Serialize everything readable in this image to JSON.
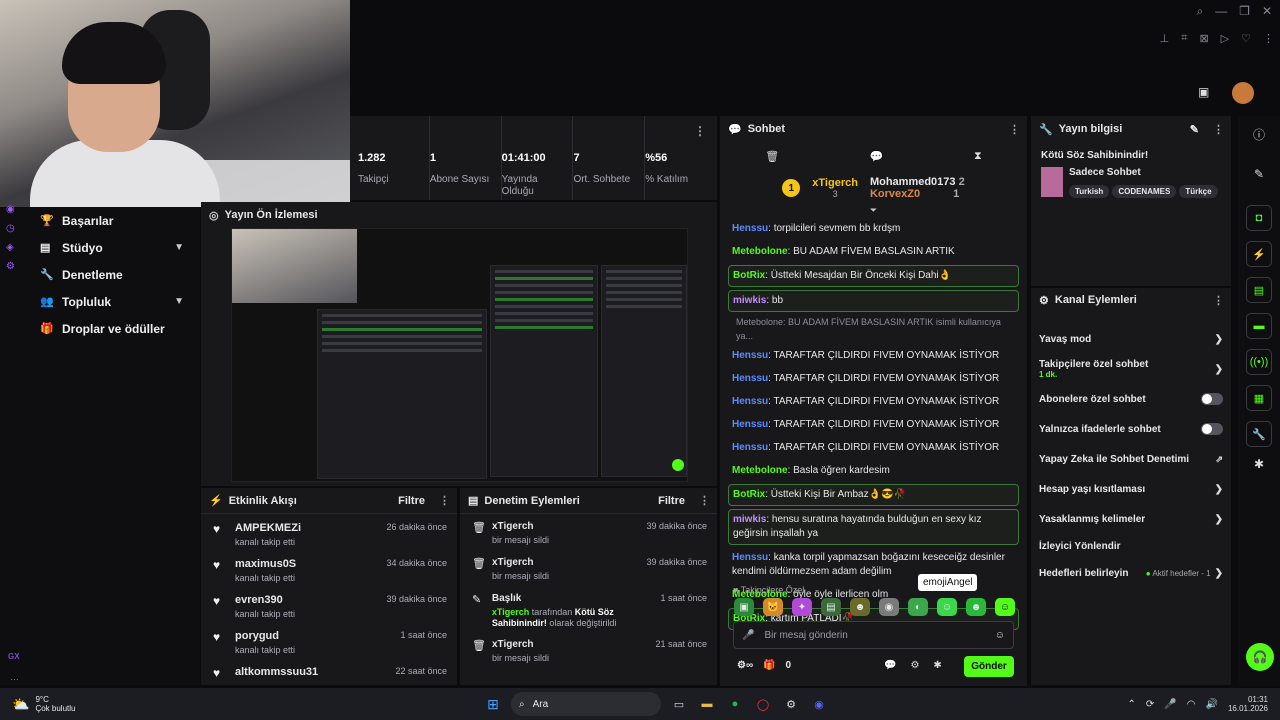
{
  "stats": [
    {
      "value": "1.282",
      "label": "Takipçi"
    },
    {
      "value": "1",
      "label": "Abone Sayısı"
    },
    {
      "value": "01:41:00",
      "label": "Yayında Olduğu"
    },
    {
      "value": "7",
      "label": "Ort. Sohbete"
    },
    {
      "value": "%56",
      "label": "% Katılım"
    }
  ],
  "nav": {
    "items": [
      "Başarılar",
      "Stüdyo",
      "Denetleme",
      "Topluluk",
      "Droplar ve ödüller"
    ]
  },
  "preview": {
    "title": "Yayın Ön İzlemesi"
  },
  "activity": {
    "title": "Etkinlik Akışı",
    "filter": "Filtre",
    "items": [
      {
        "name": "AMPEKMEZi",
        "sub": "kanalı takip etti",
        "time": "26 dakika önce"
      },
      {
        "name": "maximus0S",
        "sub": "kanalı takip etti",
        "time": "34 dakika önce"
      },
      {
        "name": "evren390",
        "sub": "kanalı takip etti",
        "time": "39 dakika önce"
      },
      {
        "name": "porygud",
        "sub": "kanalı takip etti",
        "time": "1 saat önce"
      },
      {
        "name": "altkommssuu31",
        "sub": "",
        "time": "22 saat önce"
      }
    ]
  },
  "moderation": {
    "title": "Denetim Eylemleri",
    "filter": "Filtre",
    "items": [
      {
        "icon": "trash",
        "name": "xTigerch",
        "sub": "bir mesajı sildi",
        "time": "39 dakika önce"
      },
      {
        "icon": "trash",
        "name": "xTigerch",
        "sub": "bir mesajı sildi",
        "time": "39 dakika önce"
      },
      {
        "icon": "edit",
        "name": "Başlık",
        "sub_user": "xTigerch",
        "sub_mid": " tarafından ",
        "sub_bold": "Kötü Söz Sahibinindir!",
        "sub_end": " olarak değiştirildi",
        "time": "1 saat önce"
      },
      {
        "icon": "trash",
        "name": "xTigerch",
        "sub": "bir mesajı sildi",
        "time": "21 saat önce"
      }
    ]
  },
  "chat": {
    "title": "Sohbet",
    "leader": {
      "rank": "1",
      "top": "xTigerch",
      "top_count": "3",
      "second": "Mohammed0173",
      "second_count": "2",
      "third": "KorvexZ0",
      "third_count": "1"
    },
    "messages": [
      {
        "user": "Henssu",
        "color": "#5b8cff",
        "text": "torpilcileri sevmem bb krdşm",
        "hl": false
      },
      {
        "user": "Metebolone",
        "color": "#53fc18",
        "text": "BU ADAM FİVEM BASLASIN ARTIK",
        "hl": false
      },
      {
        "user": "BotRix",
        "color": "#53fc18",
        "text": "Üstteki Mesajdan Bir Önceki Kişi Dahi👌",
        "hl": true
      },
      {
        "user": "miwkis",
        "color": "#c58cff",
        "text": "bb",
        "hl": true
      },
      {
        "reply": "Metebolone: BU ADAM FİVEM BASLASIN ARTIK isimli kullanıcıya ya..."
      },
      {
        "user": "Henssu",
        "color": "#5b8cff",
        "text": "TARAFTAR ÇILDIRDI FIVEM OYNAMAK İSTİYOR",
        "hl": false
      },
      {
        "user": "Henssu",
        "color": "#5b8cff",
        "text": "TARAFTAR ÇILDIRDI FIVEM OYNAMAK İSTİYOR",
        "hl": false
      },
      {
        "user": "Henssu",
        "color": "#5b8cff",
        "text": "TARAFTAR ÇILDIRDI FIVEM OYNAMAK İSTİYOR",
        "hl": false
      },
      {
        "user": "Henssu",
        "color": "#5b8cff",
        "text": "TARAFTAR ÇILDIRDI FIVEM OYNAMAK İSTİYOR",
        "hl": false
      },
      {
        "user": "Henssu",
        "color": "#5b8cff",
        "text": "TARAFTAR ÇILDIRDI FIVEM OYNAMAK İSTİYOR",
        "hl": false
      },
      {
        "user": "Metebolone",
        "color": "#53fc18",
        "text": "Basla öğren kardesim",
        "hl": false
      },
      {
        "user": "BotRix",
        "color": "#53fc18",
        "text": "Üstteki Kişi Bir Ambaz👌😎🥀",
        "hl": true
      },
      {
        "user": "miwkis",
        "color": "#c58cff",
        "text": "hensu suratına hayatında bulduğun en sexy kız geğirsin inşallah ya",
        "hl": true
      },
      {
        "user": "Henssu",
        "color": "#5b8cff",
        "text": "kanka torpil yapmazsan boğazını keseceiğz desinler kendimi öldürmezsem adam değilim",
        "hl": false
      },
      {
        "user": "Metebolone",
        "color": "#53fc18",
        "text": "öyle öyle ilerlicen olm",
        "hl": false
      },
      {
        "user": "BotRix",
        "color": "#53fc18",
        "text": "kartım PATLADI🥀",
        "hl": true
      }
    ],
    "follower_only": "Takipçilere Özel",
    "tooltip": "emojiAngel",
    "input_placeholder": "Bir mesaj gönderin",
    "points": "0",
    "send": "Gönder"
  },
  "info": {
    "title": "Yayın bilgisi",
    "stream_title": "Kötü Söz Sahibinindir!",
    "category": "Sadece Sohbet",
    "tags": [
      "Turkish",
      "CODENAMES",
      "Türkçe"
    ]
  },
  "channel": {
    "title": "Kanal Eylemleri",
    "rows": [
      {
        "label": "Yavaş mod",
        "type": "chev"
      },
      {
        "label": "Takipçilere özel sohbet",
        "sub": "1 dk.",
        "type": "chev"
      },
      {
        "label": "Abonelere özel sohbet",
        "type": "toggle"
      },
      {
        "label": "Yalnızca ifadelerle sohbet",
        "type": "toggle"
      },
      {
        "label": "Yapay Zeka ile Sohbet Denetimi",
        "type": "ext"
      },
      {
        "label": "Hesap yaşı kısıtlaması",
        "type": "chev"
      },
      {
        "label": "Yasaklanmış kelimeler",
        "type": "chev"
      },
      {
        "label": "İzleyici Yönlendir",
        "type": "none"
      },
      {
        "label": "Hedefleri belirleyin",
        "type": "goal",
        "extra": "Aktif hedefler - 1"
      }
    ]
  },
  "taskbar": {
    "weather_temp": "9°C",
    "weather_desc": "Çok bulutlu",
    "search": "Ara",
    "time": "01:31",
    "date": "16.01.2026"
  },
  "colors": {
    "accent": "#53fc18",
    "panel": "#18181b",
    "bg": "#0b0b0d"
  }
}
